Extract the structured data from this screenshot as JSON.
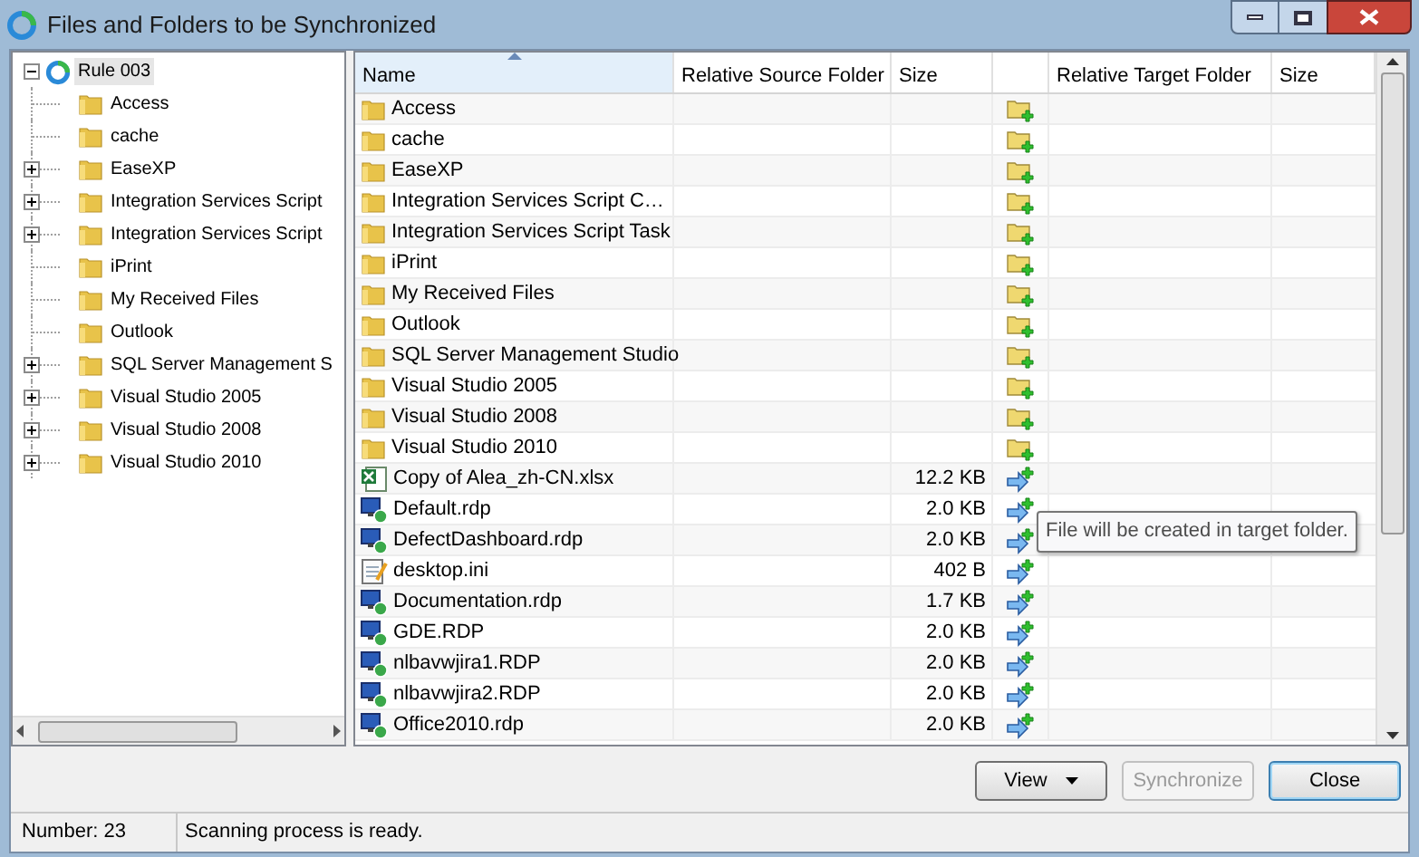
{
  "window": {
    "title": "Files and Folders to be Synchronized"
  },
  "tree": {
    "root": {
      "label": "Rule 003",
      "selected": true,
      "expanded": true
    },
    "children": [
      {
        "label": "Access",
        "expandable": false
      },
      {
        "label": "cache",
        "expandable": false
      },
      {
        "label": "EaseXP",
        "expandable": true
      },
      {
        "label": "Integration Services Script",
        "expandable": true
      },
      {
        "label": "Integration Services Script",
        "expandable": true
      },
      {
        "label": "iPrint",
        "expandable": false
      },
      {
        "label": "My Received Files",
        "expandable": false
      },
      {
        "label": "Outlook",
        "expandable": false
      },
      {
        "label": "SQL Server Management S",
        "expandable": true
      },
      {
        "label": "Visual Studio 2005",
        "expandable": true
      },
      {
        "label": "Visual Studio 2008",
        "expandable": true
      },
      {
        "label": "Visual Studio 2010",
        "expandable": true
      }
    ]
  },
  "table": {
    "columns": [
      {
        "label": "Name",
        "sorted": true
      },
      {
        "label": "Relative Source Folder",
        "sorted": false
      },
      {
        "label": "Size",
        "sorted": false
      },
      {
        "sorted": false
      },
      {
        "label": "Relative Target Folder",
        "sorted": false
      },
      {
        "label": "Size",
        "sorted": false
      }
    ],
    "rows": [
      {
        "kind": "folder",
        "name": "Access"
      },
      {
        "kind": "folder",
        "name": "cache"
      },
      {
        "kind": "folder",
        "name": "EaseXP"
      },
      {
        "kind": "folder",
        "name": "Integration Services Script C…"
      },
      {
        "kind": "folder",
        "name": "Integration Services Script Task"
      },
      {
        "kind": "folder",
        "name": "iPrint"
      },
      {
        "kind": "folder",
        "name": "My Received Files"
      },
      {
        "kind": "folder",
        "name": "Outlook"
      },
      {
        "kind": "folder",
        "name": "SQL Server Management Studio"
      },
      {
        "kind": "folder",
        "name": "Visual Studio 2005"
      },
      {
        "kind": "folder",
        "name": "Visual Studio 2008"
      },
      {
        "kind": "folder",
        "name": "Visual Studio 2010"
      },
      {
        "kind": "excel",
        "name": "Copy of Alea_zh-CN.xlsx",
        "size": "12.2 KB"
      },
      {
        "kind": "rdp",
        "name": "Default.rdp",
        "size": "2.0 KB"
      },
      {
        "kind": "rdp",
        "name": "DefectDashboard.rdp",
        "size": "2.0 KB"
      },
      {
        "kind": "ini",
        "name": "desktop.ini",
        "size": "402 B"
      },
      {
        "kind": "rdp",
        "name": "Documentation.rdp",
        "size": "1.7 KB"
      },
      {
        "kind": "rdp",
        "name": "GDE.RDP",
        "size": "2.0 KB"
      },
      {
        "kind": "rdp",
        "name": "nlbavwjira1.RDP",
        "size": "2.0 KB"
      },
      {
        "kind": "rdp",
        "name": "nlbavwjira2.RDP",
        "size": "2.0 KB"
      },
      {
        "kind": "rdp",
        "name": "Office2010.rdp",
        "size": "2.0 KB"
      }
    ]
  },
  "tooltip": {
    "text": "File will be created in target folder."
  },
  "buttons": [
    {
      "label": "View",
      "kind": "dropdown",
      "disabled": false,
      "default": false
    },
    {
      "label": "Synchronize",
      "kind": "plain",
      "disabled": true,
      "default": false
    },
    {
      "label": "Close",
      "kind": "plain",
      "disabled": false,
      "default": true
    }
  ],
  "status_bar": {
    "count": "Number: 23",
    "message": "Scanning process is ready."
  }
}
